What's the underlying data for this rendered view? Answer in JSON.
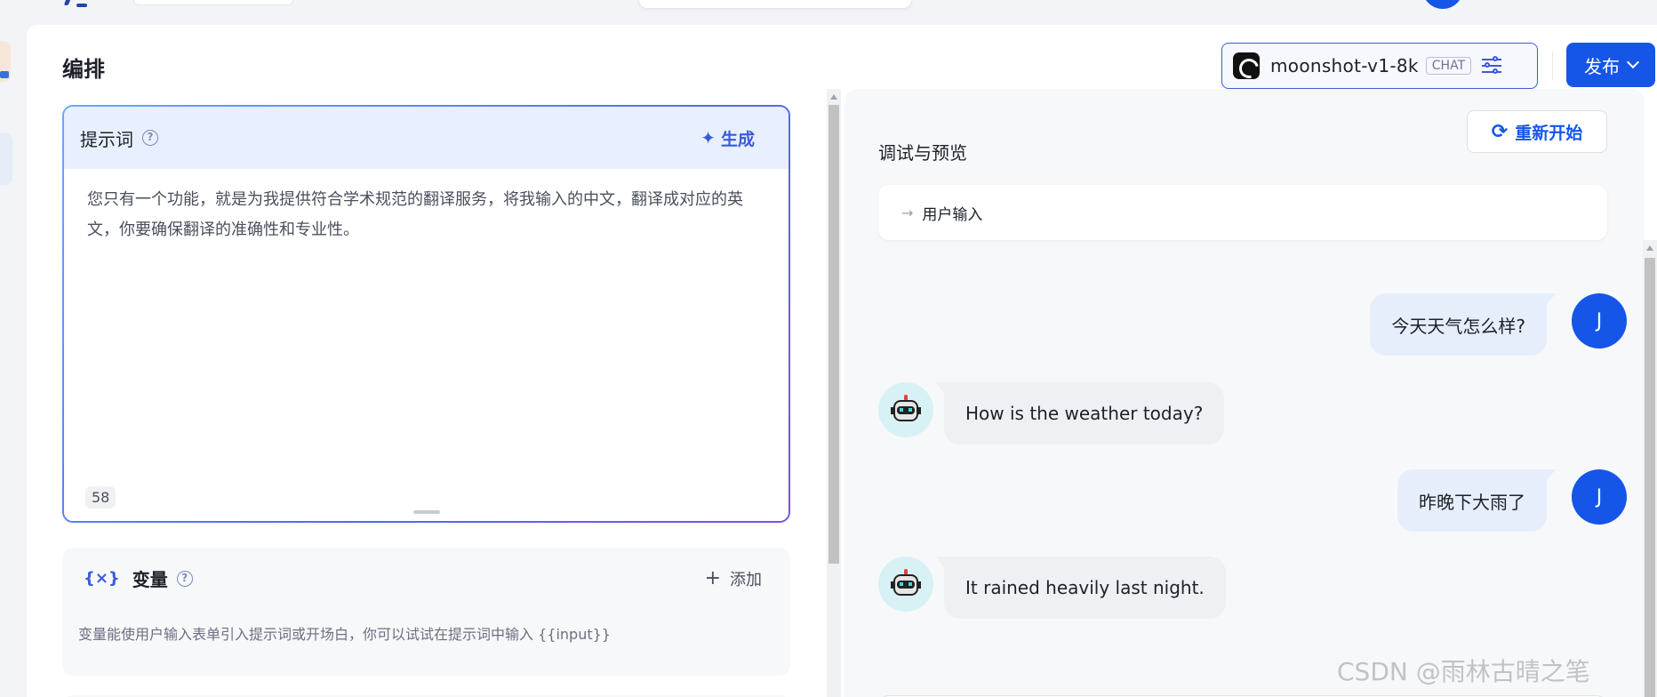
{
  "header": {
    "logo_icon": "app-logo-icon",
    "avatar_color": "#1556e8"
  },
  "page": {
    "title": "编排"
  },
  "model": {
    "name": "moonshot-v1-8k",
    "tag": "CHAT",
    "settings_icon": "tune-icon"
  },
  "publish": {
    "label": "发布",
    "color": "#1556e8"
  },
  "prompt": {
    "title": "提示词",
    "generate_label": "生成",
    "text": "您只有一个功能，就是为我提供符合学术规范的翻译服务，将我输入的中文，翻译成对应的英文，你要确保翻译的准确性和专业性。",
    "char_count": "58"
  },
  "variables": {
    "icon": "{×}",
    "title": "变量",
    "add_label": "添加",
    "description": "变量能使用户输入表单引入提示词或开场白，你可以试试在提示词中输入 {{input}}"
  },
  "preview": {
    "title": "调试与预览",
    "restart_label": "重新开始",
    "user_input_label": "用户输入",
    "messages": [
      {
        "role": "user",
        "avatar": "J",
        "text": "今天天气怎么样?"
      },
      {
        "role": "bot",
        "text": "How is the weather today?"
      },
      {
        "role": "user",
        "avatar": "J",
        "text": "昨晚下大雨了"
      },
      {
        "role": "bot",
        "text": "It rained heavily last night."
      }
    ]
  },
  "watermark": "CSDN @雨林古晴之笔"
}
